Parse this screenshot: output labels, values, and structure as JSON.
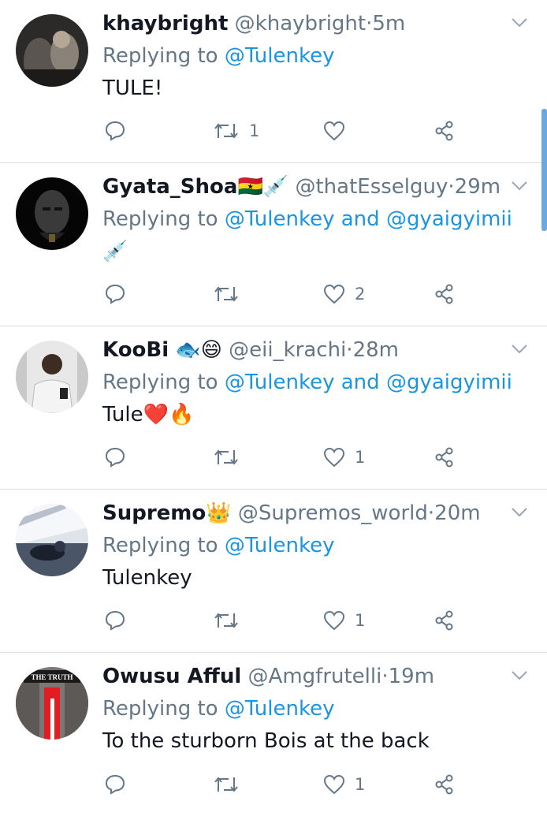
{
  "colors": {
    "link": "#1b95e0",
    "secondary": "#657786",
    "divider": "#d9dfe3",
    "heart_fill": "#e0245e"
  },
  "icons": {
    "reply": "reply-bubble-icon",
    "retweet": "retweet-icon",
    "like": "heart-icon",
    "share": "share-icon",
    "more": "chevron-down-icon"
  },
  "tweets": [
    {
      "name": "khaybright",
      "name_suffix": "",
      "handle": "@khaybright",
      "dot": "·",
      "time": "5m",
      "replying_label": "Replying to",
      "mentions": [
        "@Tulenkey"
      ],
      "joiner": "",
      "text": "TULE!",
      "retweets": "1",
      "likes": ""
    },
    {
      "name": "Gyata_Shoa",
      "name_suffix": "🇬🇭💉",
      "handle": "@thatEsselguy",
      "dot": "·",
      "time": "29m",
      "replying_label": "Replying to",
      "mentions": [
        "@Tulenkey",
        "@gyaigyimii"
      ],
      "joiner": "and",
      "text": "💉",
      "retweets": "",
      "likes": "2"
    },
    {
      "name": "KooBi",
      "name_suffix": "🐟😄",
      "handle": "@eii_krachi",
      "dot": "·",
      "time": "28m",
      "replying_label": "Replying to",
      "mentions": [
        "@Tulenkey",
        "@gyaigyimii"
      ],
      "joiner": "and",
      "text": "Tule❤️🔥",
      "retweets": "",
      "likes": "1"
    },
    {
      "name": "Supremo",
      "name_suffix": "👑",
      "handle": "@Supremos_world",
      "dot": "·",
      "time": "20m",
      "replying_label": "Replying to",
      "mentions": [
        "@Tulenkey"
      ],
      "joiner": "",
      "text": "Tulenkey",
      "retweets": "",
      "likes": "1"
    },
    {
      "name": "Owusu Afful",
      "name_suffix": "",
      "handle": "@Amgfrutelli",
      "dot": "·",
      "time": "19m",
      "replying_label": "Replying to",
      "mentions": [
        "@Tulenkey"
      ],
      "joiner": "",
      "text": "To the sturborn Bois at the back",
      "retweets": "",
      "likes": "1"
    }
  ],
  "avatars": [
    {
      "avatar_text": ""
    },
    {
      "avatar_text": ""
    },
    {
      "avatar_text": ""
    },
    {
      "avatar_text": ""
    },
    {
      "avatar_text": "THE TRUTH"
    }
  ]
}
